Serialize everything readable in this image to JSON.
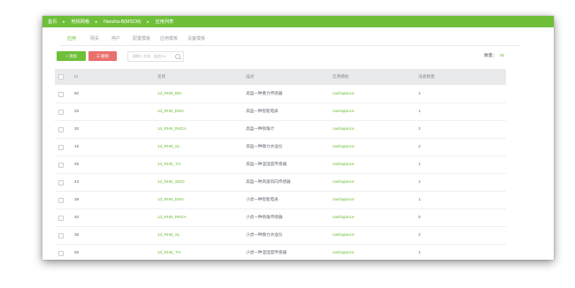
{
  "breadcrumb": [
    "首页",
    "地铁网格",
    "Nansha-B(MSCM)",
    "应用列表"
  ],
  "tabs": [
    "应用",
    "网关",
    "用户",
    "配置模板",
    "应用模板",
    "设备模板"
  ],
  "active_tab": 0,
  "toolbar": {
    "add_label": "+ 添加",
    "delete_label": "☰ 删除",
    "search_placeholder": "模糊入名称、描述EN"
  },
  "count": {
    "label": "数量：",
    "value": "35"
  },
  "table": {
    "headers": [
      "Id",
      "名称",
      "描述",
      "应用模板",
      "设备数量"
    ],
    "rows": [
      {
        "id": "60",
        "name": "1d_RHB_BM",
        "desc": "高盈一种重力传感器",
        "template": "nashajiance",
        "devices": "1"
      },
      {
        "id": "33",
        "name": "1d_RHB_DMA",
        "desc": "高盈一种智能电表",
        "template": "nashajiance",
        "devices": "1"
      },
      {
        "id": "20",
        "name": "1d_RHB_RKDA",
        "desc": "高盈一种倾角计",
        "template": "nashajiance",
        "devices": "2"
      },
      {
        "id": "19",
        "name": "1d_RHB_SL",
        "desc": "高盈一种静力水准仪",
        "template": "nashajiance",
        "devices": "2"
      },
      {
        "id": "25",
        "name": "1d_RHB_TH",
        "desc": "高盈一种温湿度传感器",
        "template": "nashajiance",
        "devices": "1"
      },
      {
        "id": "43",
        "name": "1d_RHB_WSD",
        "desc": "高盈一种风速风向传感器",
        "template": "nashajiance",
        "devices": "1"
      },
      {
        "id": "39",
        "name": "1d_RHB_DMA",
        "desc": "小虎一种智能电表",
        "template": "nashajiance",
        "devices": "1"
      },
      {
        "id": "40",
        "name": "1d_RHB_RKDA",
        "desc": "小虎一种倾角传感器",
        "template": "nashajiance",
        "devices": "5"
      },
      {
        "id": "38",
        "name": "1d_RHB_SL",
        "desc": "小虎一种静力水准仪",
        "template": "nashajiance",
        "devices": "2"
      },
      {
        "id": "55",
        "name": "1d_RHB_TH",
        "desc": "小虎一种温湿度传感器",
        "template": "nashajiance",
        "devices": "1"
      }
    ]
  },
  "colors": {
    "accent": "#6fbf3a",
    "danger": "#e9716b"
  }
}
